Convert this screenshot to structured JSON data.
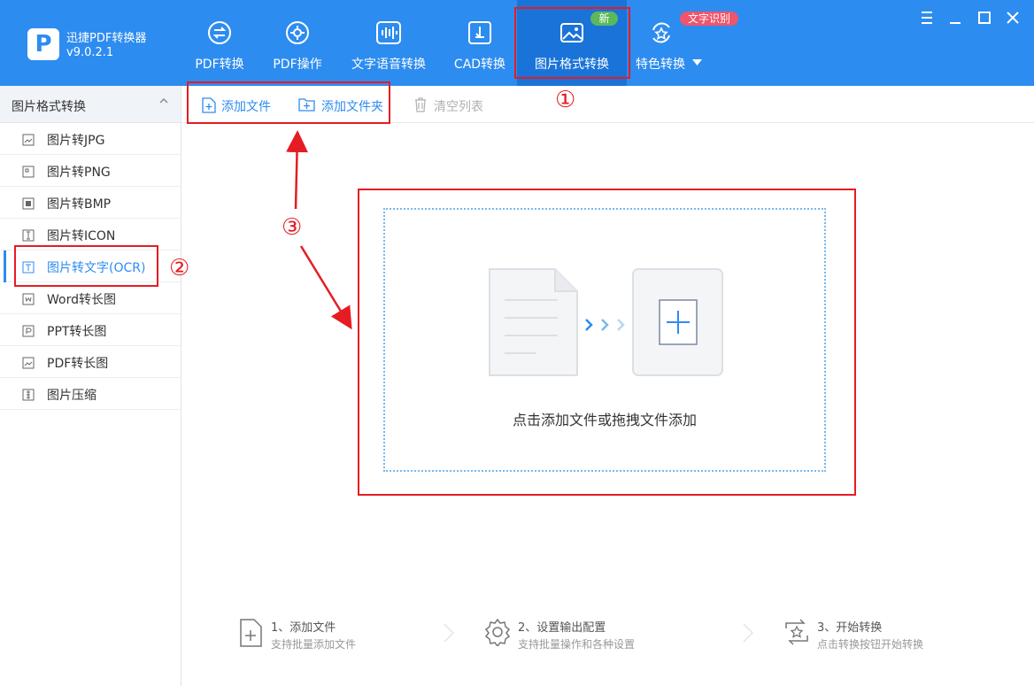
{
  "app": {
    "title": "迅捷PDF转换器",
    "version": "v9.0.2.1",
    "logo_letter": "P"
  },
  "top_tabs": [
    {
      "label": "PDF转换",
      "icon": "pdf-convert-icon"
    },
    {
      "label": "PDF操作",
      "icon": "pdf-operate-icon"
    },
    {
      "label": "文字语音转换",
      "icon": "audio-wave-icon"
    },
    {
      "label": "CAD转换",
      "icon": "cad-icon"
    },
    {
      "label": "图片格式转换",
      "icon": "image-icon",
      "active": true
    },
    {
      "label": "特色转换",
      "icon": "star-refresh-icon",
      "dropdown": true
    }
  ],
  "badges": {
    "new": "新",
    "ocr": "文字识别"
  },
  "window_controls": [
    "menu-icon",
    "minimize-icon",
    "maximize-icon",
    "close-icon"
  ],
  "sidebar": {
    "header": "图片格式转换",
    "items": [
      {
        "label": "图片转JPG"
      },
      {
        "label": "图片转PNG"
      },
      {
        "label": "图片转BMP"
      },
      {
        "label": "图片转ICON"
      },
      {
        "label": "图片转文字(OCR)",
        "active": true
      },
      {
        "label": "Word转长图"
      },
      {
        "label": "PPT转长图"
      },
      {
        "label": "PDF转长图"
      },
      {
        "label": "图片压缩"
      }
    ]
  },
  "toolbar": {
    "add_file": "添加文件",
    "add_folder": "添加文件夹",
    "clear_list": "清空列表"
  },
  "dropzone": {
    "text": "点击添加文件或拖拽文件添加"
  },
  "steps": [
    {
      "title": "1、添加文件",
      "desc": "支持批量添加文件"
    },
    {
      "title": "2、设置输出配置",
      "desc": "支持批量操作和各种设置"
    },
    {
      "title": "3、开始转换",
      "desc": "点击转换按钮开始转换"
    }
  ],
  "annotations": {
    "n1": "①",
    "n2": "②",
    "n3": "③"
  },
  "colors": {
    "brand": "#2d8cf0",
    "brand_active": "#1a73d9",
    "annotation": "#e51c23",
    "badge_new": "#5bb85b",
    "badge_ocr": "#f0556b"
  }
}
